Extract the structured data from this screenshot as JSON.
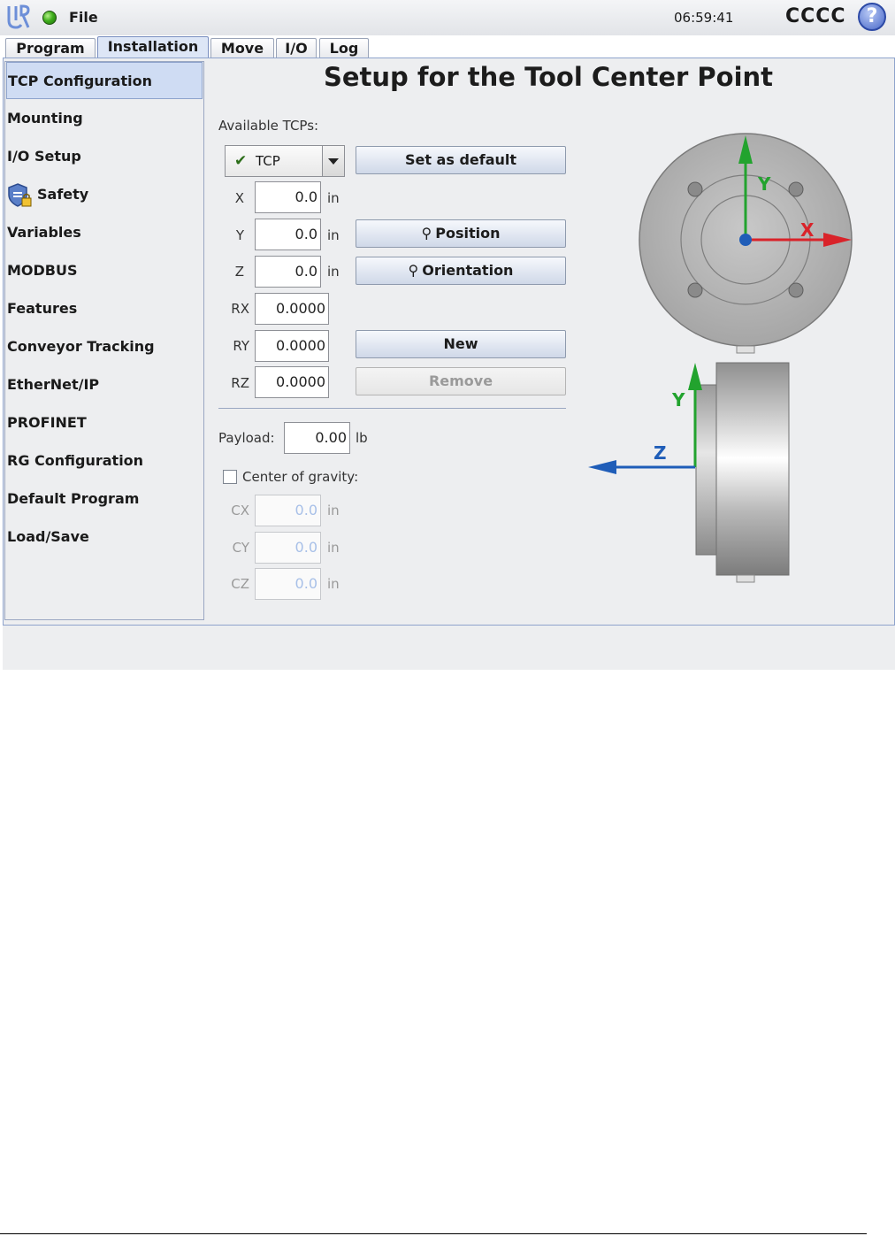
{
  "topbar": {
    "menu_file": "File",
    "clock": "06:59:41",
    "robot_name": "CCCC",
    "help": "?"
  },
  "tabs": [
    {
      "label": "Program"
    },
    {
      "label": "Installation",
      "active": true
    },
    {
      "label": "Move"
    },
    {
      "label": "I/O"
    },
    {
      "label": "Log"
    }
  ],
  "sidebar": {
    "items": [
      {
        "label": "TCP Configuration",
        "selected": true
      },
      {
        "label": "Mounting"
      },
      {
        "label": "I/O Setup"
      },
      {
        "label": "Safety",
        "icon": "shield-lock-icon"
      },
      {
        "label": "Variables"
      },
      {
        "label": "MODBUS"
      },
      {
        "label": "Features"
      },
      {
        "label": "Conveyor Tracking"
      },
      {
        "label": "EtherNet/IP"
      },
      {
        "label": "PROFINET"
      },
      {
        "label": "RG Configuration"
      },
      {
        "label": "Default Program"
      },
      {
        "label": "Load/Save"
      }
    ]
  },
  "main": {
    "title": "Setup for the Tool Center Point",
    "available_tcps_label": "Available TCPs:",
    "tcp_selected": "TCP",
    "buttons": {
      "set_default": "Set as default",
      "position": "Position",
      "orientation": "Orientation",
      "new": "New",
      "remove": "Remove"
    },
    "fields": {
      "x": {
        "label": "X",
        "value": "0.0",
        "unit": "in"
      },
      "y": {
        "label": "Y",
        "value": "0.0",
        "unit": "in"
      },
      "z": {
        "label": "Z",
        "value": "0.0",
        "unit": "in"
      },
      "rx": {
        "label": "RX",
        "value": "0.0000"
      },
      "ry": {
        "label": "RY",
        "value": "0.0000"
      },
      "rz": {
        "label": "RZ",
        "value": "0.0000"
      }
    },
    "payload": {
      "label": "Payload:",
      "value": "0.00",
      "unit": "lb"
    },
    "center_of_gravity": {
      "label": "Center of gravity:",
      "checked": false,
      "cx": {
        "label": "CX",
        "value": "0.0",
        "unit": "in"
      },
      "cy": {
        "label": "CY",
        "value": "0.0",
        "unit": "in"
      },
      "cz": {
        "label": "CZ",
        "value": "0.0",
        "unit": "in"
      }
    },
    "diagram": {
      "axis_x": "X",
      "axis_y_top": "Y",
      "axis_y_side": "Y",
      "axis_z": "Z"
    },
    "colors": {
      "x_axis": "#d9232a",
      "y_axis": "#22a32e",
      "z_axis": "#1f5db8"
    }
  }
}
